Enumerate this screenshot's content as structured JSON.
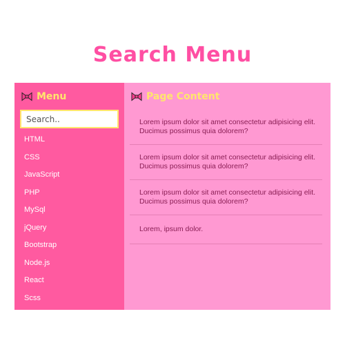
{
  "page": {
    "title": "Search Menu"
  },
  "sidebar": {
    "heading": "Menu",
    "heading_icon": "ribbon-icon",
    "search": {
      "placeholder": "Search..",
      "value": ""
    },
    "items": [
      {
        "label": "HTML"
      },
      {
        "label": "CSS"
      },
      {
        "label": "JavaScript"
      },
      {
        "label": "PHP"
      },
      {
        "label": "MySql"
      },
      {
        "label": "jQuery"
      },
      {
        "label": "Bootstrap"
      },
      {
        "label": "Node.js"
      },
      {
        "label": "React"
      },
      {
        "label": "Scss"
      }
    ]
  },
  "main": {
    "heading": "Page Content",
    "heading_icon": "ribbon-icon",
    "items": [
      {
        "text": "Lorem ipsum dolor sit amet consectetur adipisicing elit. Ducimus possimus quia dolorem?"
      },
      {
        "text": "Lorem ipsum dolor sit amet consectetur adipisicing elit. Ducimus possimus quia dolorem?"
      },
      {
        "text": "Lorem ipsum dolor sit amet consectetur adipisicing elit. Ducimus possimus quia dolorem?"
      },
      {
        "text": "Lorem, ipsum dolor."
      }
    ]
  },
  "colors": {
    "title": "#ff4fa3",
    "sidebar_bg": "#ff5aa0",
    "main_bg": "#ff99d2",
    "heading": "#ffe66d",
    "search_border": "#ffe66d",
    "menu_text": "#ffffff",
    "content_text": "#8a1f55"
  }
}
